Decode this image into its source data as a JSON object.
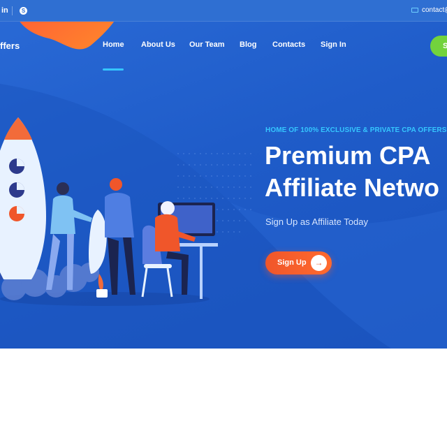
{
  "topbar": {
    "linkedin_icon": "linkedin-icon",
    "linkedin_glyph": "in",
    "skype_icon": "skype-icon",
    "skype_glyph": "S",
    "mail_icon": "mail-icon",
    "email": "contact@"
  },
  "header": {
    "logo_text": "ffers",
    "nav": [
      {
        "label": "Home",
        "active": true
      },
      {
        "label": "About Us"
      },
      {
        "label": "Our Team"
      },
      {
        "label": "Blog"
      },
      {
        "label": "Contacts"
      },
      {
        "label": "Sign In"
      }
    ],
    "cta_label": "S"
  },
  "hero": {
    "eyebrow": "HOME OF 100% EXCLUSIVE & PRIVATE CPA OFFERS",
    "headline_line1": "Premium CPA",
    "headline_line2": "Affiliate Netwo",
    "subline": "Sign Up as Affiliate Today",
    "cta_label": "Sign Up",
    "cta_icon": "arrow-right-icon",
    "cta_arrow": "→"
  },
  "colors": {
    "background": "#1f5cc9",
    "topbar": "#2f6fd2",
    "accent_cyan": "#35c6ff",
    "accent_orange": "#f0562a",
    "accent_green": "#72d33d"
  }
}
